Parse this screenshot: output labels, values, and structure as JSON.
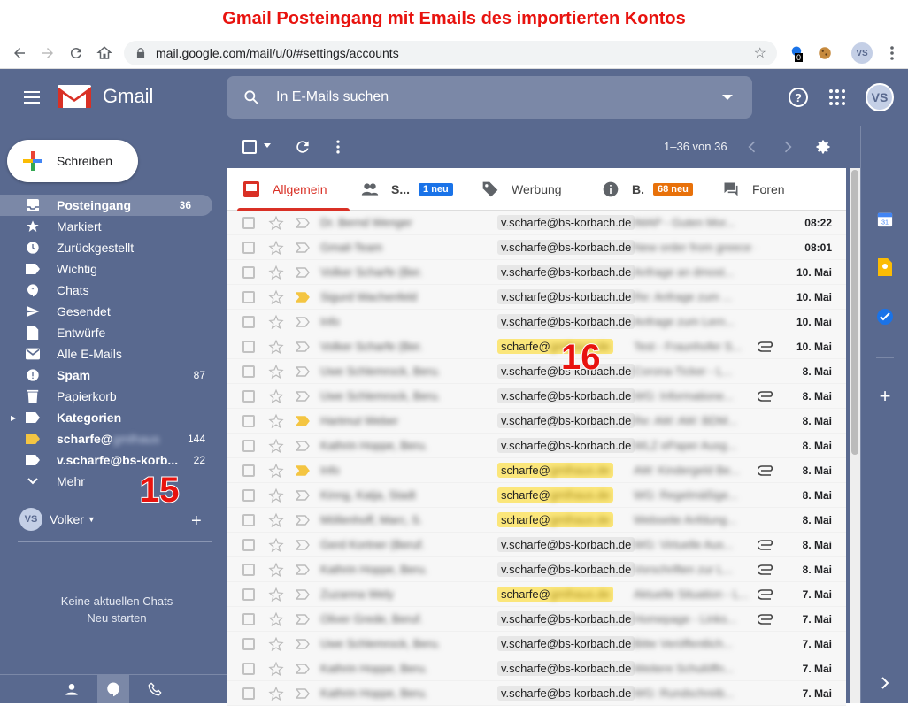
{
  "banner": {
    "title": "Gmail Posteingang mit Emails des importierten Kontos"
  },
  "browser": {
    "url": "mail.google.com/mail/u/0/#settings/accounts",
    "ext_badge": "0",
    "profile": "VS"
  },
  "header": {
    "app": "Gmail",
    "search_placeholder": "In E-Mails suchen",
    "avatar": "VS"
  },
  "compose": {
    "label": "Schreiben"
  },
  "sidebar": {
    "items": [
      {
        "label": "Posteingang",
        "count": "36"
      },
      {
        "label": "Markiert",
        "count": ""
      },
      {
        "label": "Zurückgestellt",
        "count": ""
      },
      {
        "label": "Wichtig",
        "count": ""
      },
      {
        "label": "Chats",
        "count": ""
      },
      {
        "label": "Gesendet",
        "count": ""
      },
      {
        "label": "Entwürfe",
        "count": ""
      },
      {
        "label": "Alle E-Mails",
        "count": ""
      },
      {
        "label": "Spam",
        "count": "87"
      },
      {
        "label": "Papierkorb",
        "count": ""
      },
      {
        "label": "Kategorien",
        "count": ""
      },
      {
        "label": "scharfe@",
        "count": "144"
      },
      {
        "label": "v.scharfe@bs-korb...",
        "count": "22"
      },
      {
        "label": "Mehr",
        "count": ""
      }
    ],
    "hangout_user": "Volker",
    "hangout_avatar": "VS",
    "no_chats": "Keine aktuellen Chats",
    "start_new": "Neu starten"
  },
  "annotations": {
    "n15": "15",
    "n16": "16"
  },
  "toolbar": {
    "page_info": "1–36 von 36"
  },
  "tabs": [
    {
      "label": "Allgemein",
      "badge": ""
    },
    {
      "label": "S...",
      "badge": "1 neu"
    },
    {
      "label": "Werbung",
      "badge": ""
    },
    {
      "label": "B.",
      "badge": "68 neu"
    },
    {
      "label": "Foren",
      "badge": ""
    }
  ],
  "colors": {
    "accent": "#d93025",
    "badge_blue": "#1a73e8",
    "badge_orange": "#e8710a",
    "label_yellow": "#f4c542",
    "sidebar_bg": "#59698f"
  },
  "emails": [
    {
      "sender": "Dr. Bernd Wenger",
      "account": "v.scharfe@bs-korbach.de",
      "subject": "IMAP - Guten Mor...",
      "date": "08:22",
      "yellow": false,
      "important": false,
      "clip": false
    },
    {
      "sender": "Gmail-Team",
      "account": "v.scharfe@bs-korbach.de",
      "subject": "New order from greece - Die Nachricht",
      "date": "08:01",
      "yellow": false,
      "important": false,
      "clip": false
    },
    {
      "sender": "Volker Scharfe (Ber.",
      "account": "v.scharfe@bs-korbach.de",
      "subject": "Anfrage an dmost...",
      "date": "10. Mai",
      "yellow": false,
      "important": false,
      "clip": false
    },
    {
      "sender": "Sigurd Wachenfeld",
      "account": "v.scharfe@bs-korbach.de",
      "subject": "Re: Anfrage zum ...",
      "date": "10. Mai",
      "yellow": false,
      "important": true,
      "clip": false
    },
    {
      "sender": "Info",
      "account": "v.scharfe@bs-korbach.de",
      "subject": "Anfrage zum Lern...",
      "date": "10. Mai",
      "yellow": false,
      "important": false,
      "clip": false
    },
    {
      "sender": "Volker Scharfe (Ber.",
      "account": "scharfe@",
      "subject": "Test - Fraunhofer S...",
      "date": "10. Mai",
      "yellow": true,
      "important": false,
      "clip": true
    },
    {
      "sender": "Uwe Schlemrock, Beru.",
      "account": "v.scharfe@bs-korbach.de",
      "subject": "Corona-Ticker - L...",
      "date": "8. Mai",
      "yellow": false,
      "important": false,
      "clip": false
    },
    {
      "sender": "Uwe Schlemrock, Beru.",
      "account": "v.scharfe@bs-korbach.de",
      "subject": "WG: Informatione...",
      "date": "8. Mai",
      "yellow": false,
      "important": false,
      "clip": true
    },
    {
      "sender": "Hartmut Weber",
      "account": "v.scharfe@bs-korbach.de",
      "subject": "Re: AW: AW: BDM...",
      "date": "8. Mai",
      "yellow": false,
      "important": true,
      "clip": false
    },
    {
      "sender": "Kathrin Hoppe, Beru.",
      "account": "v.scharfe@bs-korbach.de",
      "subject": "WLZ ePaper Ausg...",
      "date": "8. Mai",
      "yellow": false,
      "important": false,
      "clip": false
    },
    {
      "sender": "Info",
      "account": "scharfe@",
      "subject": "AW: Kindergeld Be...",
      "date": "8. Mai",
      "yellow": true,
      "important": true,
      "clip": true
    },
    {
      "sender": "Kinng, Katja, Stadt",
      "account": "scharfe@",
      "subject": "WG: Regelmäßige...",
      "date": "8. Mai",
      "yellow": true,
      "important": false,
      "clip": false
    },
    {
      "sender": "Möllenhoff, Marc, S.",
      "account": "scharfe@",
      "subject": "Webseite Anfdung...",
      "date": "8. Mai",
      "yellow": true,
      "important": false,
      "clip": false
    },
    {
      "sender": "Gerd Kortner (Beruf.",
      "account": "v.scharfe@bs-korbach.de",
      "subject": "WG: Virtuelle Aus...",
      "date": "8. Mai",
      "yellow": false,
      "important": false,
      "clip": true
    },
    {
      "sender": "Kathrin Hoppe, Beru.",
      "account": "v.scharfe@bs-korbach.de",
      "subject": "Vorschriften zur L...",
      "date": "8. Mai",
      "yellow": false,
      "important": false,
      "clip": true
    },
    {
      "sender": "Zuzanna Wely",
      "account": "scharfe@",
      "subject": "Aktuelle Situation - L...",
      "date": "7. Mai",
      "yellow": true,
      "important": false,
      "clip": true
    },
    {
      "sender": "Oliver Grede, Beruf.",
      "account": "v.scharfe@bs-korbach.de",
      "subject": "Homepage - Links...",
      "date": "7. Mai",
      "yellow": false,
      "important": false,
      "clip": true
    },
    {
      "sender": "Uwe Schlemrock, Beru.",
      "account": "v.scharfe@bs-korbach.de",
      "subject": "Bitte Veröffentlich...",
      "date": "7. Mai",
      "yellow": false,
      "important": false,
      "clip": false
    },
    {
      "sender": "Kathrin Hoppe, Beru.",
      "account": "v.scharfe@bs-korbach.de",
      "subject": "Weitere Schulöffn...",
      "date": "7. Mai",
      "yellow": false,
      "important": false,
      "clip": false
    },
    {
      "sender": "Kathrin Hoppe, Beru.",
      "account": "v.scharfe@bs-korbach.de",
      "subject": "WG: Rundschreib...",
      "date": "7. Mai",
      "yellow": false,
      "important": false,
      "clip": false
    }
  ]
}
